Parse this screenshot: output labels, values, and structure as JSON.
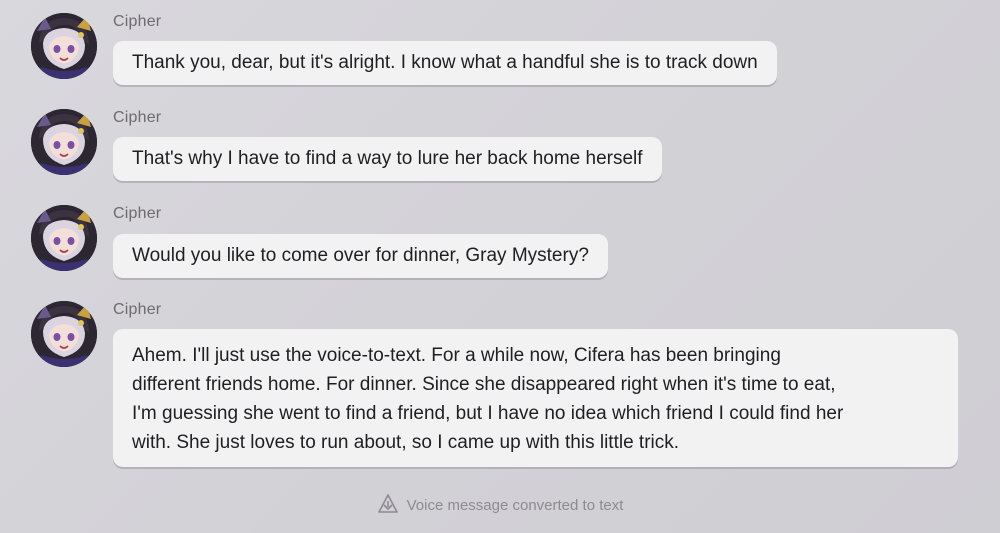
{
  "messages": [
    {
      "sender": "Cipher",
      "lines": [
        "Thank you, dear, but it's alright. I know what a handful she is to track down"
      ]
    },
    {
      "sender": "Cipher",
      "lines": [
        "That's why I have to find a way to lure her back home herself"
      ]
    },
    {
      "sender": "Cipher",
      "lines": [
        "Would you like to come over for dinner, Gray Mystery?"
      ]
    },
    {
      "sender": "Cipher",
      "lines": [
        "Ahem. I'll just use the voice-to-text. For a while now, Cifera has been bringing",
        "different friends home. For dinner. Since she disappeared right when it's time to eat,",
        "I'm guessing she went to find a friend, but I have no idea which friend I could find her",
        "with. She just loves to run about, so I came up with this little trick."
      ]
    }
  ],
  "footer": {
    "icon": "voice-message-icon",
    "text": "Voice message converted to text"
  },
  "colors": {
    "background": "#d6d5da",
    "bubble": "#f2f2f3",
    "sender_text": "#6d6b70",
    "message_text": "#1f1f22",
    "footer_text": "#8d8b90"
  }
}
